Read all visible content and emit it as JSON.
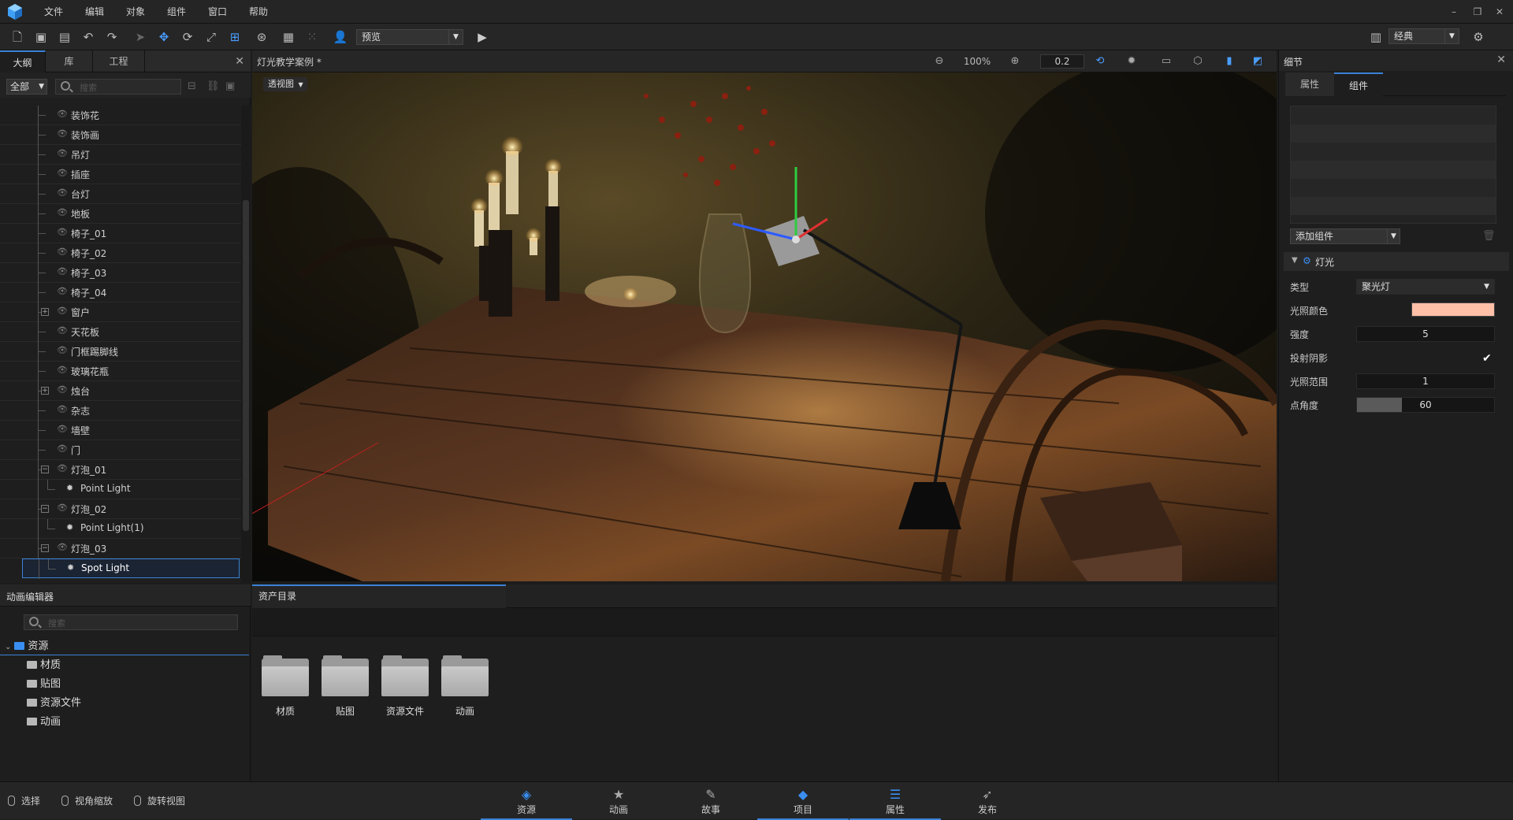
{
  "menu": {
    "items": [
      "文件",
      "编辑",
      "对象",
      "组件",
      "窗口",
      "帮助"
    ]
  },
  "toolbar": {
    "preview_label": "预览",
    "layout_label": "经典"
  },
  "left_panel": {
    "tabs": [
      "大纲",
      "库",
      "工程"
    ],
    "filter_label": "全部",
    "search_placeholder": "搜索",
    "tree": [
      {
        "label": "装饰花",
        "level": 1
      },
      {
        "label": "装饰画",
        "level": 1
      },
      {
        "label": "吊灯",
        "level": 1
      },
      {
        "label": "插座",
        "level": 1
      },
      {
        "label": "台灯",
        "level": 1
      },
      {
        "label": "地板",
        "level": 1
      },
      {
        "label": "椅子_01",
        "level": 1
      },
      {
        "label": "椅子_02",
        "level": 1
      },
      {
        "label": "椅子_03",
        "level": 1
      },
      {
        "label": "椅子_04",
        "level": 1
      },
      {
        "label": "窗户",
        "level": 1,
        "expander": "+"
      },
      {
        "label": "天花板",
        "level": 1
      },
      {
        "label": "门框踢脚线",
        "level": 1
      },
      {
        "label": "玻璃花瓶",
        "level": 1
      },
      {
        "label": "烛台",
        "level": 1,
        "expander": "+"
      },
      {
        "label": "杂志",
        "level": 1
      },
      {
        "label": "墙壁",
        "level": 1
      },
      {
        "label": "门",
        "level": 1
      },
      {
        "label": "灯泡_01",
        "level": 1,
        "expander": "−"
      },
      {
        "label": "Point Light",
        "level": 2
      },
      {
        "label": "灯泡_02",
        "level": 1,
        "expander": "−"
      },
      {
        "label": "Point Light(1)",
        "level": 2
      },
      {
        "label": "灯泡_03",
        "level": 1,
        "expander": "−"
      },
      {
        "label": "Spot Light",
        "level": 2,
        "selected": true
      }
    ]
  },
  "viewport": {
    "title": "灯光教学案例 *",
    "zoom": "100%",
    "snap": "0.2",
    "view_mode": "透视图"
  },
  "right_panel": {
    "title": "细节",
    "tabs": [
      "属性",
      "组件"
    ],
    "add_component_label": "添加组件",
    "light_section": "灯光",
    "props": {
      "type_label": "类型",
      "type_value": "聚光灯",
      "color_label": "光照颜色",
      "color_value": "#ffc0a8",
      "intensity_label": "强度",
      "intensity_value": "5",
      "shadow_label": "投射阴影",
      "shadow_checked": true,
      "range_label": "光照范围",
      "range_value": "1",
      "angle_label": "点角度",
      "angle_value": "60",
      "angle_fraction": 0.33
    }
  },
  "anim_panel": {
    "title": "动画编辑器",
    "search_placeholder": "搜索",
    "root": "资源",
    "children": [
      "材质",
      "贴图",
      "资源文件",
      "动画"
    ]
  },
  "asset_panel": {
    "tab": "资产目录",
    "folders": [
      "材质",
      "贴图",
      "资源文件",
      "动画"
    ]
  },
  "statusbar": {
    "hints": [
      "选择",
      "视角缩放",
      "旋转视图"
    ],
    "tabs": [
      {
        "label": "资源",
        "icon": "cube-stack-icon",
        "active": true
      },
      {
        "label": "动画",
        "icon": "star-icon",
        "active": false
      },
      {
        "label": "故事",
        "icon": "magic-wand-icon",
        "active": false
      },
      {
        "label": "项目",
        "icon": "layers-icon",
        "active": true
      },
      {
        "label": "属性",
        "icon": "sliders-icon",
        "active": true
      },
      {
        "label": "发布",
        "icon": "rocket-icon",
        "active": false
      }
    ]
  }
}
